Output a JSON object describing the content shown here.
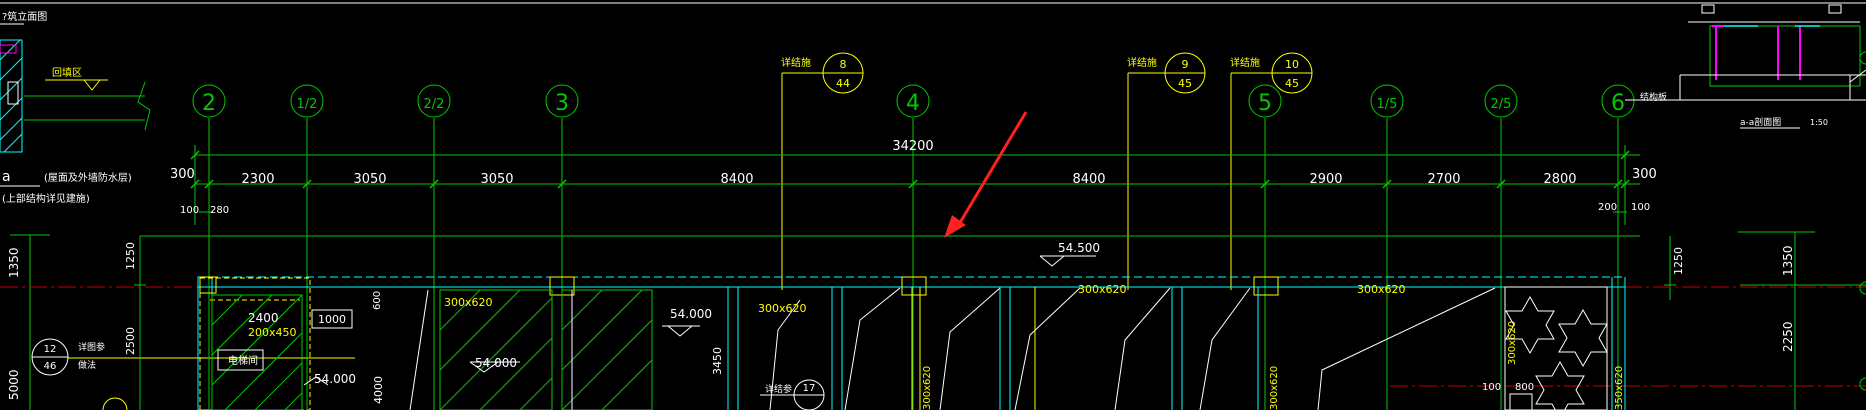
{
  "colors": {
    "background": "#000000",
    "grid_line": "#00c800",
    "dim_text": "#ffffff",
    "label_yellow": "#ffff00",
    "wall_cyan": "#00ffff",
    "axis_red": "#c00000",
    "arrow_red": "#ff2020",
    "magenta": "#ff00ff"
  },
  "top_note": "?筑立面图",
  "left_panel": {
    "fill_text": "回填区",
    "label_a": "a",
    "note1": "(屋面及外墙防水层)",
    "note2": "(上部结构详见建施)",
    "elev_1350": "1350",
    "elev_2500": "2500",
    "elev_5000": "5000",
    "ref_num": "12",
    "ref_den": "46",
    "ref_note": "详图参",
    "ref_note2": "做法"
  },
  "axes": [
    {
      "label": "2"
    },
    {
      "label": "1/2"
    },
    {
      "label": "2/2"
    },
    {
      "label": "3"
    },
    {
      "label": "4"
    },
    {
      "label": "5"
    },
    {
      "label": "1/5"
    },
    {
      "label": "2/5"
    },
    {
      "label": "6"
    }
  ],
  "details": [
    {
      "prefix": "详结施",
      "num": "8",
      "den": "44"
    },
    {
      "prefix": "详结施",
      "num": "9",
      "den": "45"
    },
    {
      "prefix": "详结施",
      "num": "10",
      "den": "45"
    }
  ],
  "dims": {
    "total": "34200",
    "segments": [
      "2300",
      "3050",
      "3050",
      "8400",
      "8400",
      "2900",
      "2700",
      "2800"
    ],
    "left_300": "300",
    "right_300": "300",
    "left_100": "100",
    "left_280": "280",
    "right_200": "200",
    "right_100": "100",
    "left_1250": "1250",
    "left_2500": "2500",
    "right_1250": "1250",
    "right_1350": "1350",
    "right_2250": "2250"
  },
  "elevations": {
    "top": "54.500",
    "mid_left": "54.000",
    "mid_center": "54.000",
    "low_left": "54.000"
  },
  "beams": {
    "b1": "300x620",
    "b2": "300x620",
    "b3": "300x620",
    "b4": "300x620",
    "b5": "200x450",
    "dim_2400": "2400",
    "dim_1000": "1000",
    "dim_600": "600",
    "dim_3450": "3450",
    "dim_4000": "4000",
    "stair_note": "电梯间",
    "v_beam1": "300x620",
    "v_beam2": "300x620",
    "v_beam3": "350x620",
    "v_beam4": "300x620",
    "dim_100": "100",
    "dim_800": "800",
    "ref17_num": "17",
    "ref17_prefix": "详结参"
  },
  "top_right": {
    "section_title": "a-a剖面图",
    "scale": "1:50",
    "right_note": "结构板"
  }
}
